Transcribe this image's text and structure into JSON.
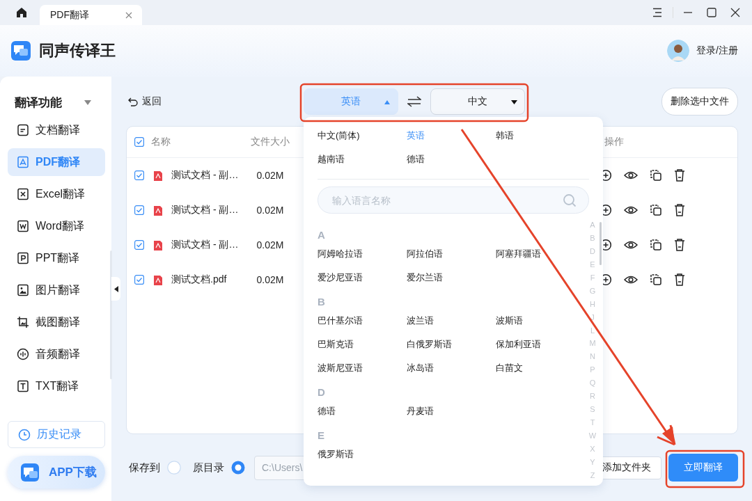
{
  "tab_bar": {
    "tabs": [
      {
        "label": "PDF翻译",
        "selected": true
      }
    ]
  },
  "header": {
    "app_name": "同声传译王",
    "login": "登录/注册"
  },
  "sidebar": {
    "heading": "翻译功能",
    "expanded": true,
    "items": [
      {
        "kind": "doc",
        "label": "文档翻译",
        "selected": false
      },
      {
        "kind": "pdf",
        "label": "PDF翻译",
        "selected": true
      },
      {
        "kind": "excel",
        "label": "Excel翻译",
        "selected": false
      },
      {
        "kind": "word",
        "label": "Word翻译",
        "selected": false
      },
      {
        "kind": "ppt",
        "label": "PPT翻译",
        "selected": false
      },
      {
        "kind": "image",
        "label": "图片翻译",
        "selected": false
      },
      {
        "kind": "screenshot",
        "label": "截图翻译",
        "selected": false
      },
      {
        "kind": "audio",
        "label": "音频翻译",
        "selected": false
      },
      {
        "kind": "txt",
        "label": "TXT翻译",
        "selected": false
      }
    ],
    "history": "历史记录",
    "app_download": "APP下载"
  },
  "toolbar": {
    "back": "返回",
    "source_language": {
      "value": "英语",
      "expanded": true
    },
    "target_language": {
      "value": "中文",
      "expanded": false
    },
    "delete_button": "删除选中文件"
  },
  "file_table": {
    "all_checked": true,
    "columns": [
      "名称",
      "文件大小",
      "操作"
    ],
    "rows": [
      {
        "checked": true,
        "name": "测试文档 - 副…",
        "size": "0.02M"
      },
      {
        "checked": true,
        "name": "测试文档 - 副…",
        "size": "0.02M"
      },
      {
        "checked": true,
        "name": "测试文档 - 副…",
        "size": "0.02M"
      },
      {
        "checked": true,
        "name": "测试文档.pdf",
        "size": "0.02M"
      }
    ]
  },
  "footer": {
    "save_options": [
      {
        "label": "保存到",
        "selected": false
      },
      {
        "label": "原目录",
        "selected": true
      }
    ],
    "path": "C:\\Users\\",
    "add_folder": "添加文件夹",
    "translate": "立即翻译"
  },
  "language_dropdown": {
    "hot": [
      {
        "label": "中文(简体)",
        "selected": false
      },
      {
        "label": "英语",
        "selected": true
      },
      {
        "label": "韩语",
        "selected": false
      },
      {
        "label": "越南语",
        "selected": false
      },
      {
        "label": "德语",
        "selected": false
      }
    ],
    "search_placeholder": "输入语言名称",
    "groups": [
      {
        "letter": "A",
        "languages": [
          "阿姆哈拉语",
          "阿拉伯语",
          "阿塞拜疆语",
          "爱沙尼亚语",
          "爱尔兰语"
        ]
      },
      {
        "letter": "B",
        "languages": [
          "巴什基尔语",
          "波兰语",
          "波斯语",
          "巴斯克语",
          "白俄罗斯语",
          "保加利亚语",
          "波斯尼亚语",
          "冰岛语",
          "白苗文"
        ]
      },
      {
        "letter": "D",
        "languages": [
          "德语",
          "丹麦语"
        ]
      },
      {
        "letter": "E",
        "languages": [
          "俄罗斯语"
        ]
      }
    ],
    "index_letters": [
      "A",
      "B",
      "D",
      "E",
      "F",
      "G",
      "H",
      "J",
      "L",
      "M",
      "N",
      "P",
      "Q",
      "R",
      "S",
      "T",
      "W",
      "X",
      "Y",
      "Z"
    ]
  }
}
